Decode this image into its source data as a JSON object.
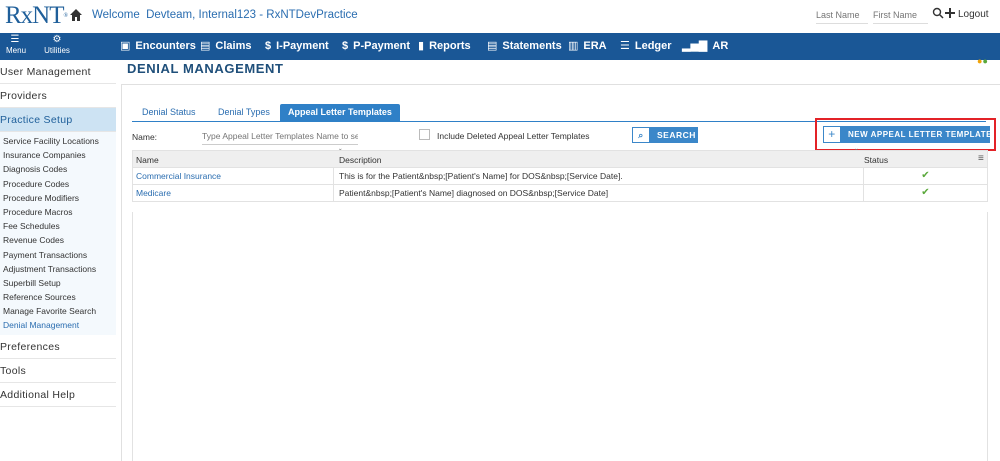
{
  "topbar": {
    "logo": "RxNT",
    "logo_mark": "®",
    "welcome": "Welcome  Devteam, Internal123 - RxNTDevPractice",
    "last_name_placeholder": "Last Name",
    "first_name_placeholder": "First Name",
    "logout": "Logout",
    "icons": [
      "home-icon",
      "search-icon",
      "plus-icon"
    ]
  },
  "navbar": {
    "menu_label": "Menu",
    "utilities_label": "Utilities",
    "items": [
      {
        "label": "Encounters",
        "icon": "encounters-icon"
      },
      {
        "label": "Claims",
        "icon": "claims-icon"
      },
      {
        "label": "I-Payment",
        "icon": "dollar-icon"
      },
      {
        "label": "P-Payment",
        "icon": "dollar-icon"
      },
      {
        "label": "Reports",
        "icon": "reports-icon"
      },
      {
        "label": "Statements",
        "icon": "statements-icon"
      },
      {
        "label": "ERA",
        "icon": "era-icon"
      },
      {
        "label": "Ledger",
        "icon": "ledger-icon"
      },
      {
        "label": "AR",
        "icon": "ar-chart-icon"
      }
    ]
  },
  "sidebar": {
    "sections": [
      "User Management",
      "Providers",
      "Practice Setup",
      "Preferences",
      "Tools",
      "Additional Help"
    ],
    "practice_setup_items": [
      "Service Facility Locations",
      "Insurance Companies",
      "Diagnosis Codes",
      "Procedure Codes",
      "Procedure Modifiers",
      "Procedure Macros",
      "Fee Schedules",
      "Revenue Codes",
      "Payment Transactions",
      "Adjustment Transactions",
      "Superbill Setup",
      "Reference Sources",
      "Manage Favorite Search",
      "Denial Management"
    ]
  },
  "main": {
    "title": "DENIAL MANAGEMENT",
    "tabs": [
      "Denial Status",
      "Denial Types",
      "Appeal Letter Templates"
    ],
    "active_tab": "Appeal Letter Templates",
    "name_label": "Name:",
    "name_placeholder": "Type Appeal Letter Templates Name to search",
    "include_deleted_label": "Include Deleted Appeal Letter Templates",
    "search_button": "SEARCH",
    "new_button": "NEW APPEAL LETTER TEMPLATE",
    "grid": {
      "columns": [
        "Name",
        "Description",
        "Status"
      ],
      "rows": [
        {
          "name": "Commercial Insurance",
          "description": "This is for the Patient&nbsp;[Patient's Name] for DOS&nbsp;[Service Date].",
          "status": "✔"
        },
        {
          "name": "Medicare",
          "description": "Patient&nbsp;[Patient's Name] diagnosed on DOS&nbsp;[Service Date]",
          "status": "✔"
        }
      ]
    }
  },
  "colors": {
    "nav_bg": "#1a5796",
    "accent": "#3b87c9",
    "highlight_box": "#e32227",
    "status_check": "#5aa83b"
  }
}
